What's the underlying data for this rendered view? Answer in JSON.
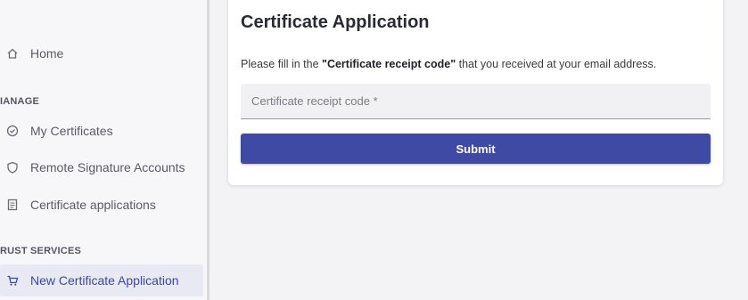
{
  "sidebar": {
    "items": [
      {
        "label": "Home",
        "icon": "home-icon"
      },
      {
        "label": "My Certificates",
        "icon": "check-circle-icon"
      },
      {
        "label": "Remote Signature Accounts",
        "icon": "shield-icon"
      },
      {
        "label": "Certificate applications",
        "icon": "document-icon"
      },
      {
        "label": "New Certificate Application",
        "icon": "cart-icon"
      }
    ],
    "section_manage": "IANAGE",
    "section_trust": "RUST SERVICES",
    "active_item": "New Certificate Application"
  },
  "card": {
    "title": "Certificate Application",
    "desc_prefix": "Please fill in the ",
    "desc_bold": "\"Certificate receipt code\"",
    "desc_suffix": " that you received at your email address.",
    "input_placeholder": "Certificate receipt code *",
    "input_value": "",
    "submit_label": "Submit"
  },
  "colors": {
    "accent": "#3f4aa5",
    "active_bg": "#e8e9f3",
    "page_bg": "#f3f3f5"
  }
}
